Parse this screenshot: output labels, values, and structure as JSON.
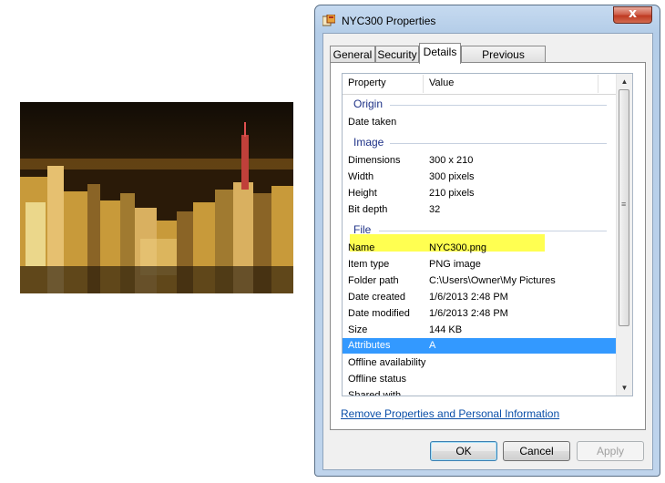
{
  "window": {
    "title": "NYC300 Properties",
    "close_glyph": "x"
  },
  "tabs": [
    {
      "label": "General"
    },
    {
      "label": "Security"
    },
    {
      "label": "Details",
      "active": true
    },
    {
      "label": "Previous Versions"
    }
  ],
  "table": {
    "col_property": "Property",
    "col_value": "Value",
    "groups": {
      "origin": "Origin",
      "image": "Image",
      "file": "File"
    },
    "rows": {
      "date_taken": {
        "property": "Date taken",
        "value": ""
      },
      "dimensions": {
        "property": "Dimensions",
        "value": "300 x 210"
      },
      "width": {
        "property": "Width",
        "value": "300 pixels"
      },
      "height": {
        "property": "Height",
        "value": "210 pixels"
      },
      "bit_depth": {
        "property": "Bit depth",
        "value": "32"
      },
      "name": {
        "property": "Name",
        "value": "NYC300.png"
      },
      "item_type": {
        "property": "Item type",
        "value": "PNG image"
      },
      "folder_path": {
        "property": "Folder path",
        "value": "C:\\Users\\Owner\\My Pictures"
      },
      "date_created": {
        "property": "Date created",
        "value": "1/6/2013 2:48 PM"
      },
      "date_modified": {
        "property": "Date modified",
        "value": "1/6/2013 2:48 PM"
      },
      "size": {
        "property": "Size",
        "value": "144 KB"
      },
      "attributes": {
        "property": "Attributes",
        "value": "A"
      },
      "offline_availability": {
        "property": "Offline availability",
        "value": ""
      },
      "offline_status": {
        "property": "Offline status",
        "value": ""
      },
      "shared_with": {
        "property": "Shared with",
        "value": ""
      }
    },
    "selected_row": "Attributes",
    "highlighted_row": "Width",
    "highlight_color": "#ffff33",
    "selection_color": "#3399ff"
  },
  "link": {
    "label": "Remove Properties and Personal Information"
  },
  "buttons": {
    "ok": "OK",
    "cancel": "Cancel",
    "apply": "Apply"
  },
  "icons": {
    "window": "properties-icon",
    "scroll_up": "scroll-up-arrow-icon",
    "scroll_down": "scroll-down-arrow-icon"
  }
}
